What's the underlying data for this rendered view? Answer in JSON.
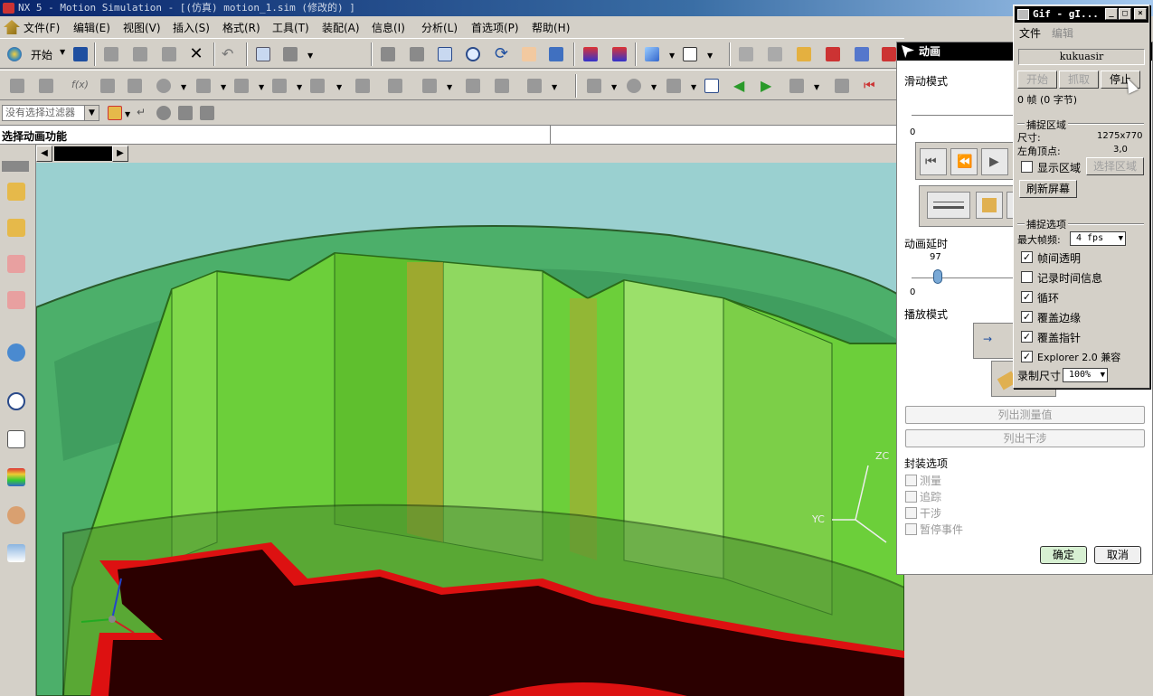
{
  "window": {
    "title": "NX 5 - Motion Simulation - [(仿真) motion_1.sim (修改的) ]"
  },
  "menu": [
    "文件(F)",
    "编辑(E)",
    "视图(V)",
    "插入(S)",
    "格式(R)",
    "工具(T)",
    "装配(A)",
    "信息(I)",
    "分析(L)",
    "首选项(P)",
    "帮助(H)"
  ],
  "toolbar": {
    "start_label": "开始"
  },
  "filter": {
    "placeholder": "没有选择过滤器"
  },
  "cue": {
    "text": "选择动画功能"
  },
  "triad": {
    "zc": "ZC",
    "yc": "YC"
  },
  "animation_dialog": {
    "title": "动画",
    "slider_mode_label": "滑动模式",
    "slider_min": "0",
    "delay_label": "动画延时",
    "delay_value": "97",
    "delay_min": "0",
    "playback_label": "播放模式",
    "list_measure_label": "列出测量值",
    "list_interference_label": "列出干涉",
    "envelope_label": "封装选项",
    "envelope_options": [
      "测量",
      "追踪",
      "干涉",
      "暂停事件"
    ],
    "ok_label": "确定",
    "cancel_label": "取消"
  },
  "gif_window": {
    "title": "Gif - gI...",
    "menu": [
      "文件",
      "编辑"
    ],
    "name": "kukuasir",
    "start_label": "开始",
    "grab_label": "抓取",
    "stop_label": "停止",
    "frames_text": "0 帧 (0 字节)",
    "capture_area_label": "捕捉区域",
    "size_label": "尺寸:",
    "size_value": "1275x770",
    "corner_label": "左角顶点:",
    "corner_value": "3,0",
    "show_area_label": "显示区域",
    "select_area_label": "选择区域",
    "refresh_label": "刷新屏幕",
    "capture_options_label": "捕捉选项",
    "max_fps_label": "最大帧频:",
    "max_fps_value": "4 fps",
    "options": [
      {
        "label": "帧间透明",
        "checked": true
      },
      {
        "label": "记录时间信息",
        "checked": false
      },
      {
        "label": "循环",
        "checked": true
      },
      {
        "label": "覆盖边缘",
        "checked": true
      },
      {
        "label": "覆盖指针",
        "checked": true
      },
      {
        "label": "Explorer 2.0 兼容",
        "checked": true
      }
    ],
    "record_size_label": "录制尺寸",
    "record_size_value": "100%"
  }
}
